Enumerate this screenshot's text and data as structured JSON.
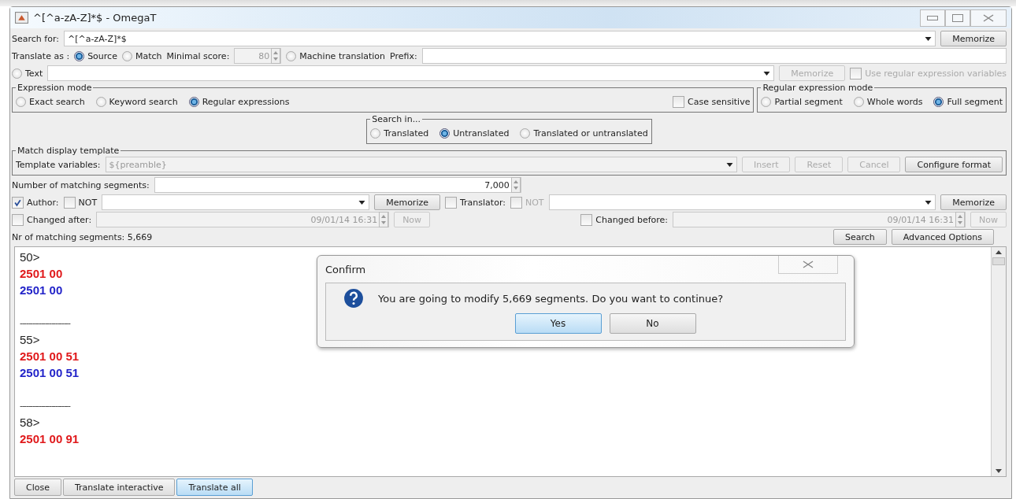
{
  "window": {
    "title": "^[^a-zA-Z]*$ - OmegaT"
  },
  "search": {
    "label": "Search for:",
    "value": "^[^a-zA-Z]*$",
    "memorize": "Memorize"
  },
  "translate_as": {
    "label": "Translate as :",
    "options": [
      {
        "label": "Source",
        "selected": true
      },
      {
        "label": "Match",
        "selected": false
      }
    ],
    "min_score_label": "Minimal score:",
    "min_score": "80",
    "mt": {
      "label": "Machine translation",
      "selected": false
    },
    "prefix_label": "Prefix:"
  },
  "text_row": {
    "label": "Text",
    "selected": false,
    "memorize": "Memorize",
    "use_regex": {
      "label": "Use regular expression variables",
      "checked": false,
      "disabled": true
    }
  },
  "expression_mode": {
    "title": "Expression mode",
    "options": [
      {
        "label": "Exact search",
        "selected": false
      },
      {
        "label": "Keyword search",
        "selected": false
      },
      {
        "label": "Regular expressions",
        "selected": true
      }
    ],
    "case_sensitive": {
      "label": "Case sensitive",
      "checked": false
    }
  },
  "regex_mode": {
    "title": "Regular expression mode",
    "options": [
      {
        "label": "Partial segment",
        "selected": false
      },
      {
        "label": "Whole words",
        "selected": false
      },
      {
        "label": "Full segment",
        "selected": true
      }
    ]
  },
  "search_in": {
    "title": "Search in...",
    "options": [
      {
        "label": "Translated",
        "selected": false
      },
      {
        "label": "Untranslated",
        "selected": true
      },
      {
        "label": "Translated or untranslated",
        "selected": false
      }
    ]
  },
  "template": {
    "title": "Match display template",
    "label": "Template variables:",
    "value": "${preamble}",
    "buttons": [
      {
        "label": "Insert",
        "disabled": true
      },
      {
        "label": "Reset",
        "disabled": true
      },
      {
        "label": "Cancel",
        "disabled": true
      },
      {
        "label": "Configure format",
        "disabled": false
      }
    ]
  },
  "matching": {
    "label": "Number of matching segments:",
    "value": "7,000"
  },
  "author": {
    "label": "Author:",
    "checked": true,
    "not_label": "NOT",
    "not_checked": false,
    "memorize": "Memorize"
  },
  "translator": {
    "label": "Translator:",
    "checked": false,
    "not_label": "NOT",
    "not_checked": false,
    "memorize": "Memorize"
  },
  "changed_after": {
    "label": "Changed after:",
    "checked": false,
    "value": "09/01/14 16:31",
    "now": "Now"
  },
  "changed_before": {
    "label": "Changed before:",
    "checked": false,
    "value": "09/01/14 16:31",
    "now": "Now"
  },
  "status": "Nr of matching segments: 5,669",
  "actions": [
    "Search",
    "Advanced Options"
  ],
  "results": [
    {
      "kind": "number",
      "text": "50>"
    },
    {
      "kind": "source",
      "text": "2501 00"
    },
    {
      "kind": "target",
      "text": "2501 00"
    },
    {
      "kind": "separator",
      "text": "------------------------"
    },
    {
      "kind": "number",
      "text": "55>"
    },
    {
      "kind": "source",
      "text": "2501 00 51"
    },
    {
      "kind": "target",
      "text": "2501 00 51"
    },
    {
      "kind": "separator",
      "text": "------------------------"
    },
    {
      "kind": "number",
      "text": "58>"
    },
    {
      "kind": "source",
      "text": "2501 00 91"
    }
  ],
  "dialog": {
    "title": "Confirm",
    "message": "You are going to modify 5,669 segments. Do you want to continue?",
    "buttons": [
      {
        "label": "Yes",
        "selected": true
      },
      {
        "label": "No",
        "selected": false
      }
    ]
  },
  "bottom_buttons": [
    {
      "label": "Close",
      "selected": false
    },
    {
      "label": "Translate interactive",
      "selected": false
    },
    {
      "label": "Translate all",
      "selected": true
    }
  ]
}
